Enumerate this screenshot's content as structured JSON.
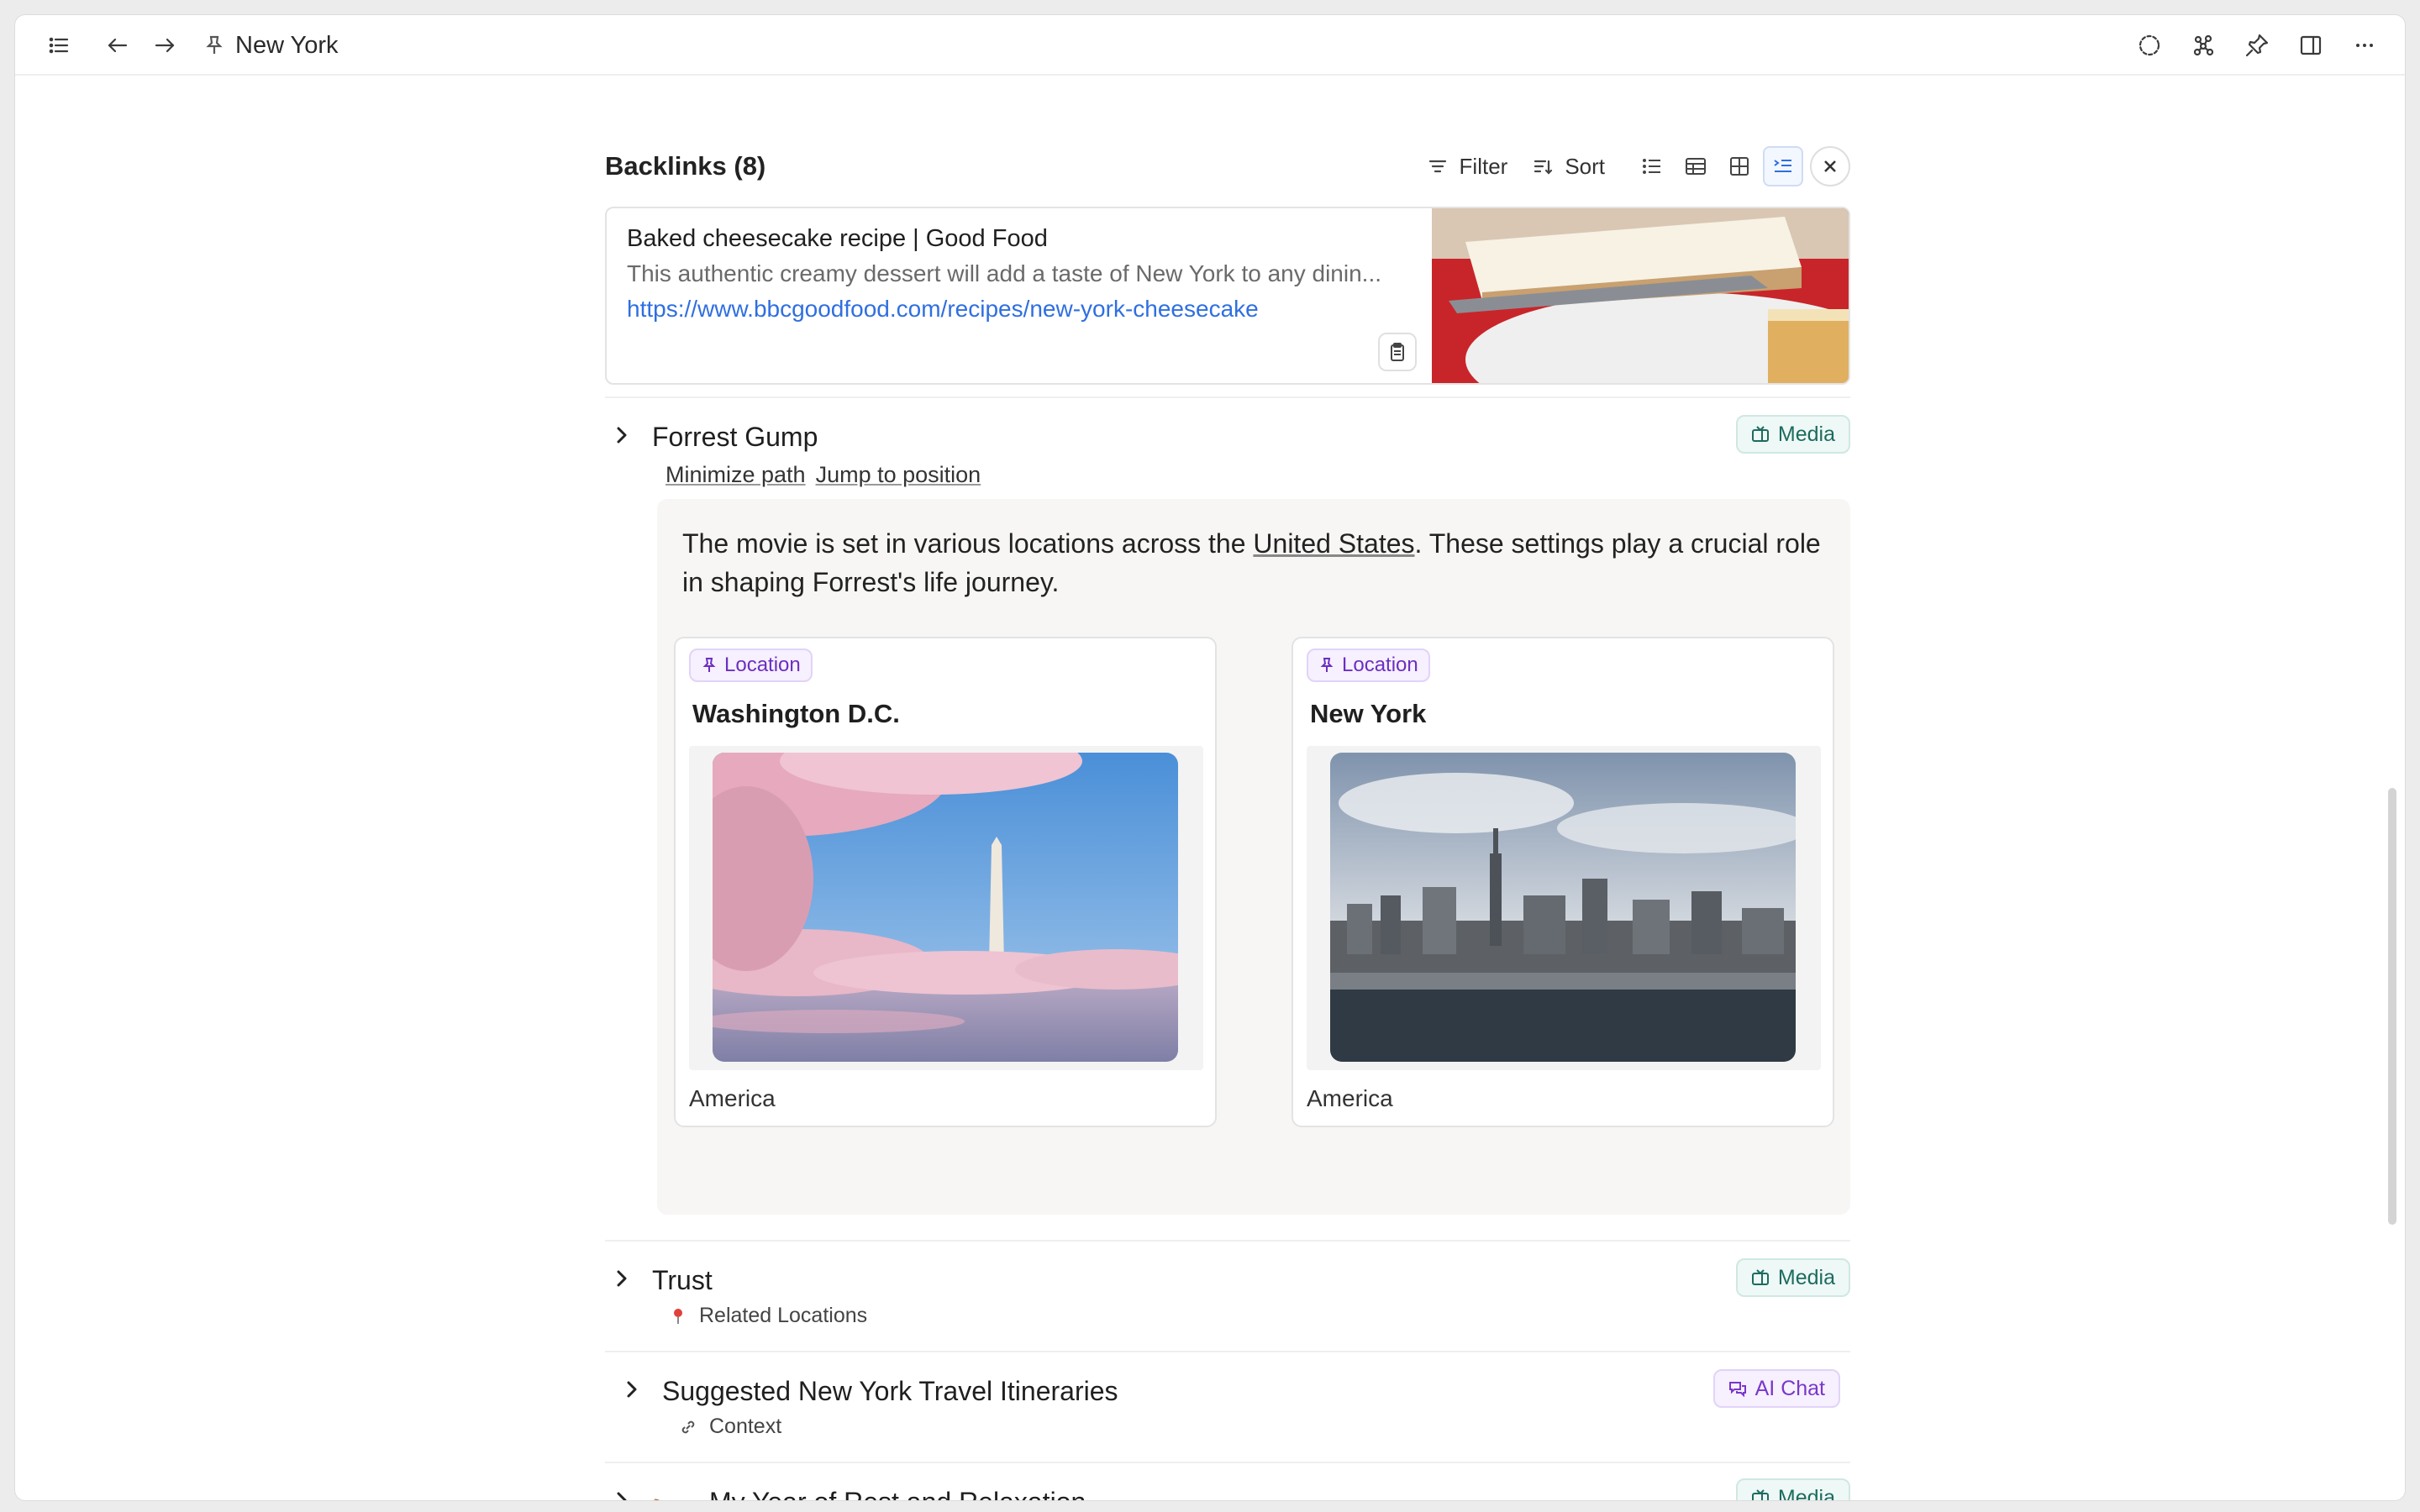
{
  "topbar": {
    "title": "New York",
    "icons": [
      "list-icon",
      "arrow-left-icon",
      "arrow-right-icon",
      "pin-icon",
      "dashed-circle-icon",
      "graph-icon",
      "pin-icon",
      "sidebar-icon",
      "more-icon"
    ]
  },
  "backlinks": {
    "title": "Backlinks (8)",
    "filter_label": "Filter",
    "sort_label": "Sort"
  },
  "bookmark": {
    "title": "Baked cheesecake recipe | Good Food",
    "description": "This authentic creamy dessert will add a taste of New York to any dinin...",
    "url": "https://www.bbcgoodfood.com/recipes/new-york-cheesecake"
  },
  "entries": [
    {
      "title": "Forrest Gump",
      "badge": "Media",
      "links": [
        "Minimize path",
        "Jump to position"
      ],
      "block": {
        "text_before": "The movie is set in various locations across the ",
        "link_text": "United States",
        "text_after": ". These settings play a crucial role in shaping Forrest's life journey."
      },
      "cards": [
        {
          "badge": "Location",
          "name": "Washington D.C.",
          "footer": "America"
        },
        {
          "badge": "Location",
          "name": "New York",
          "footer": "America"
        }
      ]
    },
    {
      "title": "Trust",
      "badge": "Media",
      "sub": "Related Locations"
    },
    {
      "title": "Suggested New York Travel Itineraries",
      "badge": "AI Chat",
      "sub": "Context"
    },
    {
      "title": "My Year of Rest and Relaxation",
      "badge": "Media",
      "emoji": "🛏️"
    }
  ],
  "colors": {
    "accent_blue": "#2f6fe0",
    "media_badge": "#1d6b5f",
    "location_badge": "#6b2fbf"
  }
}
